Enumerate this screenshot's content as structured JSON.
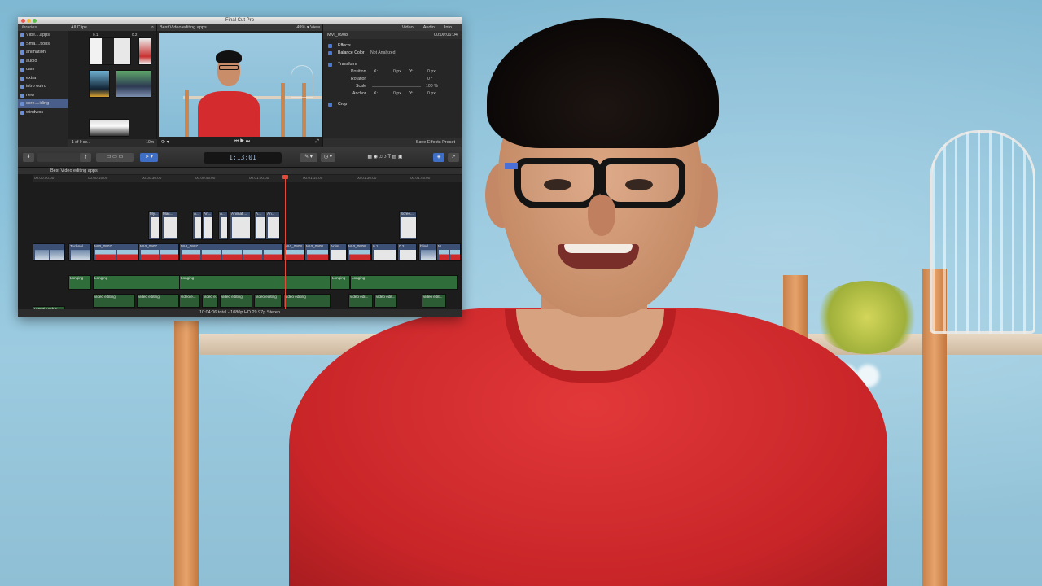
{
  "window": {
    "title": "Final Cut Pro"
  },
  "libraries": {
    "header": "Libraries",
    "items": [
      {
        "label": "Vide....apps",
        "selected": false
      },
      {
        "label": "Sma....tions",
        "selected": false
      },
      {
        "label": "animation",
        "selected": false
      },
      {
        "label": "audio",
        "selected": false
      },
      {
        "label": "cam",
        "selected": false
      },
      {
        "label": "extra",
        "selected": false
      },
      {
        "label": "intro outro",
        "selected": false
      },
      {
        "label": "new",
        "selected": false
      },
      {
        "label": "scre....iding",
        "selected": true
      },
      {
        "label": "windwos",
        "selected": false
      }
    ]
  },
  "browser": {
    "filter": "All Clips",
    "thumb_labels": [
      "0.1",
      "0.2"
    ],
    "selection_count": "1 of 9 se...",
    "duration": "10m"
  },
  "viewer": {
    "title": "Best Video editing apps",
    "zoom": "49%",
    "view_menu": "View"
  },
  "inspector": {
    "tabs": [
      "Video",
      "Audio",
      "Info"
    ],
    "clip_name": "MVI_0908",
    "clip_time": "00:00:06:04",
    "effects_label": "Effects",
    "balance_color_label": "Balance Color",
    "balance_color_value": "Not Analyzed",
    "transform_label": "Transform",
    "position_label": "Position",
    "position_x": "0 px",
    "position_y": "0 px",
    "rotation_label": "Rotation",
    "rotation_value": "0 °",
    "scale_label": "Scale",
    "scale_value": "100 %",
    "anchor_label": "Anchor",
    "anchor_x": "0 px",
    "anchor_y": "0 px",
    "axis_x": "X:",
    "axis_y": "Y:",
    "crop_label": "Crop",
    "save_preset": "Save Effects Preset"
  },
  "toolbar": {
    "timecode": "1:13:01"
  },
  "timeline": {
    "project_name": "Best Video editing apps",
    "ruler": [
      "00:00:00:00",
      "00:00:15:00",
      "00:00:30:00",
      "00:00:45:00",
      "00:01:00:00",
      "00:01:15:00",
      "00:01:30:00",
      "00:01:45:00"
    ],
    "storyline_labels": [
      "Technol...",
      "MVI_0907",
      "MVI_0907",
      "MVI_0907",
      "MVI_0908",
      "MVI_0908",
      "Anim...",
      "MVI_0908",
      "0.1",
      "0.2",
      "blind",
      "M..."
    ],
    "upper_labels": [
      "My...",
      "Mac...",
      "A...",
      "An...",
      "A...",
      "Animati...",
      "A...",
      "An...",
      "Scree..."
    ],
    "music_labels": [
      "Longing",
      "Longing",
      "Longing",
      "Longing",
      "Longing"
    ],
    "voice_labels": [
      "video editing",
      "video editing",
      "video e...",
      "video e...",
      "video editing",
      "video editing",
      "video editing",
      "video edi...",
      "video edit...",
      "video edit..."
    ],
    "bottom_labels": [
      "Dreval Dark F...",
      "let's see video editing"
    ],
    "status": "10:04:06 total - 1080p HD 29.97p Stereo"
  }
}
